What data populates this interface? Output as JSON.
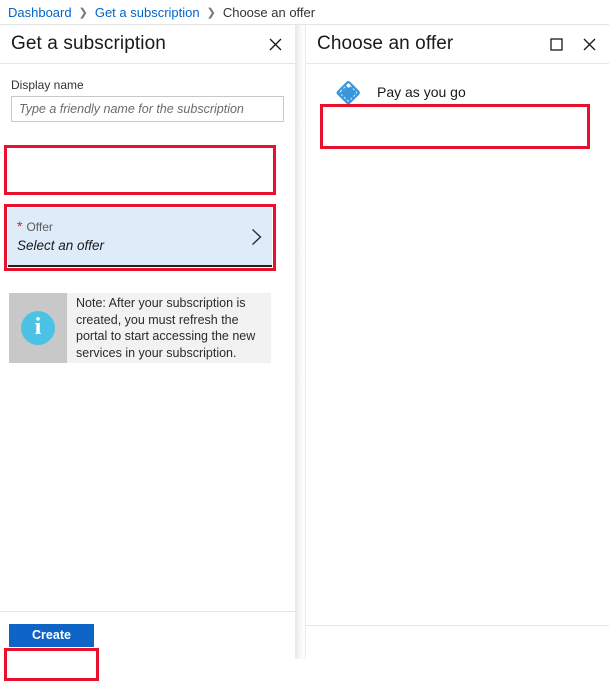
{
  "breadcrumb": {
    "items": [
      {
        "label": "Dashboard",
        "type": "link"
      },
      {
        "label": "Get a subscription",
        "type": "link"
      },
      {
        "label": "Choose an offer",
        "type": "current"
      }
    ],
    "separator": "❯"
  },
  "left_panel": {
    "title": "Get a subscription",
    "close_icon": "close-icon",
    "display_name": {
      "label": "Display name",
      "value": "",
      "placeholder": "Type a friendly name for the subscription"
    },
    "offer": {
      "required_marker": "*",
      "label": "Offer",
      "value": "Select an offer",
      "chevron_icon": "chevron-right-icon"
    },
    "note": {
      "icon": "info-icon",
      "icon_glyph": "i",
      "text": "Note: After your subscription is created, you must refresh the portal to start accessing the new services in your subscription."
    },
    "footer": {
      "create_label": "Create"
    }
  },
  "right_panel": {
    "title": "Choose an offer",
    "maximize_icon": "maximize-icon",
    "close_icon": "close-icon",
    "offers": [
      {
        "label": "Pay as you go",
        "icon": "price-tag-icon"
      }
    ]
  },
  "colors": {
    "annotation_red": "#e8112d",
    "link_blue": "#0066cc",
    "button_blue": "#0f64c8",
    "field_highlight": "#deecf9",
    "tag_icon_blue": "#3a96dd",
    "info_icon_blue": "#4cc2e4",
    "required_red": "#e81123"
  }
}
